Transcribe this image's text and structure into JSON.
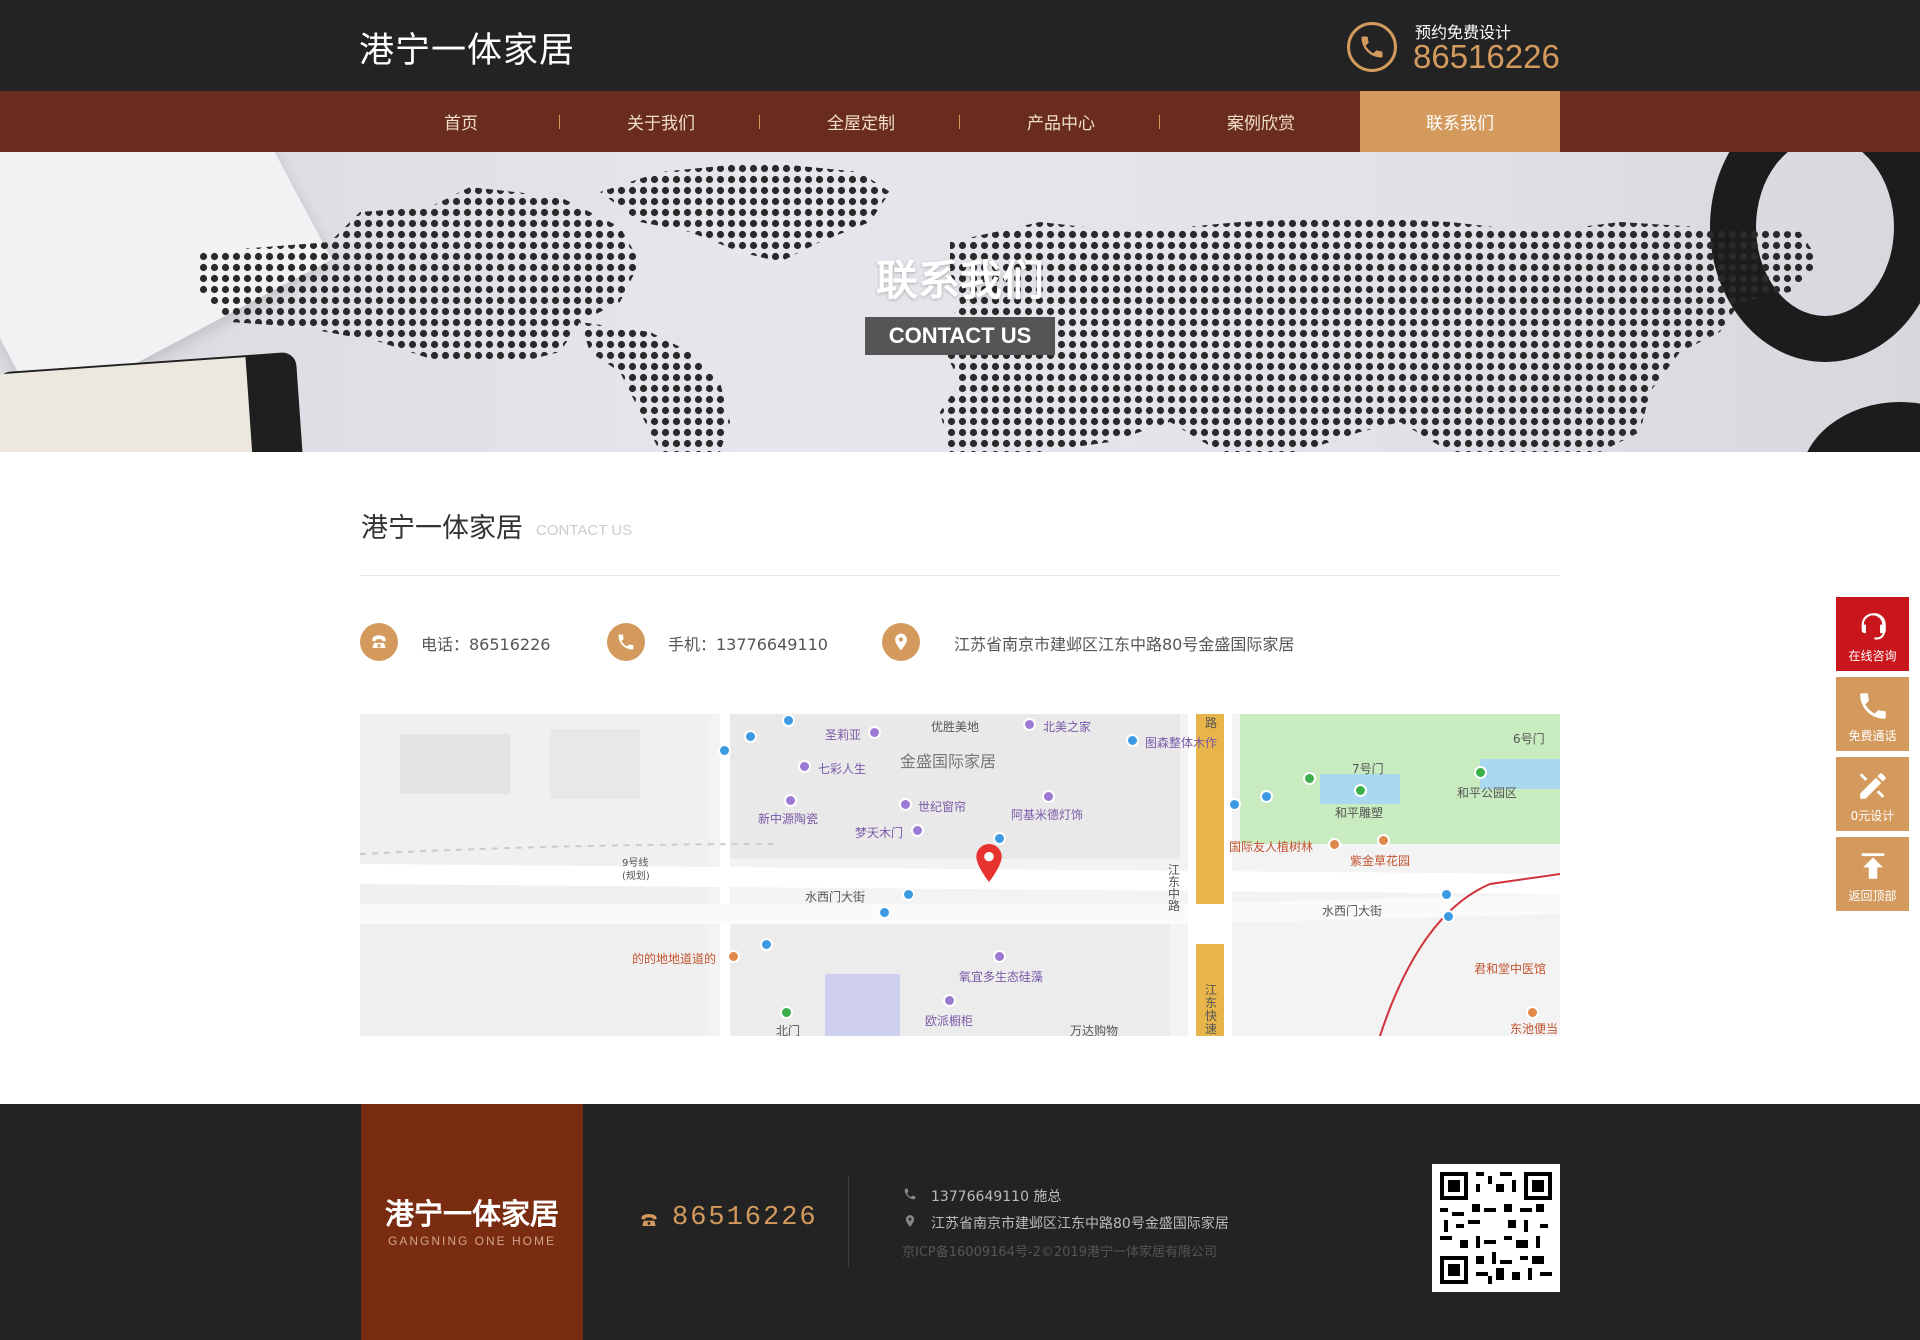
{
  "header": {
    "logo": "港宁一体家居",
    "hotline_label": "预约免费设计",
    "hotline_number": "86516226"
  },
  "nav": {
    "items": [
      {
        "label": "首页",
        "active": false
      },
      {
        "label": "关于我们",
        "active": false
      },
      {
        "label": "全屋定制",
        "active": false
      },
      {
        "label": "产品中心",
        "active": false
      },
      {
        "label": "案例欣赏",
        "active": false
      },
      {
        "label": "联系我们",
        "active": true
      }
    ]
  },
  "banner": {
    "title": "联系我们",
    "subtitle": "CONTACT US"
  },
  "section": {
    "title": "港宁一体家居",
    "subtitle": "CONTACT US"
  },
  "contact": {
    "phone": "电话：86516226",
    "mobile": "手机：13776649110",
    "address": "江苏省南京市建邺区江东中路80号金盛国际家居"
  },
  "map": {
    "labels": {
      "jinsheng": "金盛国际家居",
      "shengliya": "圣莉亚",
      "youshengmeidi": "优胜美地",
      "beimeizhijia": "北美之家",
      "tusen": "图森整体木作",
      "qicairensheng": "七彩人生",
      "shijichuanglian": "世纪窗帘",
      "xinzhongyuan": "新中源陶瓷",
      "mengtianmumen": "梦天木门",
      "ajimi": "阿基米德灯饰",
      "shuiximen1": "水西门大街",
      "shuiximen2": "水西门大街",
      "didi": "的的地地道道的",
      "shiyiduo": "氧宜多生态硅藻",
      "oupai": "欧派橱柜",
      "wanda": "万达购物",
      "beimen": "北门",
      "line9": "9号线",
      "line9b": "(规划)",
      "jiangdongzhonglu": "江东中路",
      "jiangdongkuaisu": "江东快速",
      "guojiyouren": "国际友人植树林",
      "zijincao": "紫金草花园",
      "hepingdiaosu": "和平雕塑",
      "hepinggongyuan": "和平公园区",
      "men7": "7号门",
      "men6": "6号门",
      "junhetang": "君和堂中医馆",
      "dongchi": "东池便当",
      "lu": "路"
    }
  },
  "footer": {
    "brand": "港宁一体家居",
    "brand_en": "GANGNING ONE HOME",
    "phone": "86516226",
    "mobile_line": "13776649110  施总",
    "address_line": "江苏省南京市建邺区江东中路80号金盛国际家居",
    "icp": "京ICP备16009164号-2©2019港宁一体家居有限公司"
  },
  "side": {
    "items": [
      {
        "label": "在线咨询",
        "icon": "headset-icon",
        "color": "#c9161c"
      },
      {
        "label": "免费通话",
        "icon": "phone-icon",
        "color": "#d49a5d"
      },
      {
        "label": "0元设计",
        "icon": "pencil-ruler-icon",
        "color": "#d49a5d"
      },
      {
        "label": "返回顶部",
        "icon": "arrow-up-icon",
        "color": "#d49a5d"
      }
    ]
  },
  "colors": {
    "accent": "#d49a5d",
    "nav_bg": "#6b2c20",
    "dark_bg": "#232323",
    "brand_bg": "#7a2c10"
  }
}
